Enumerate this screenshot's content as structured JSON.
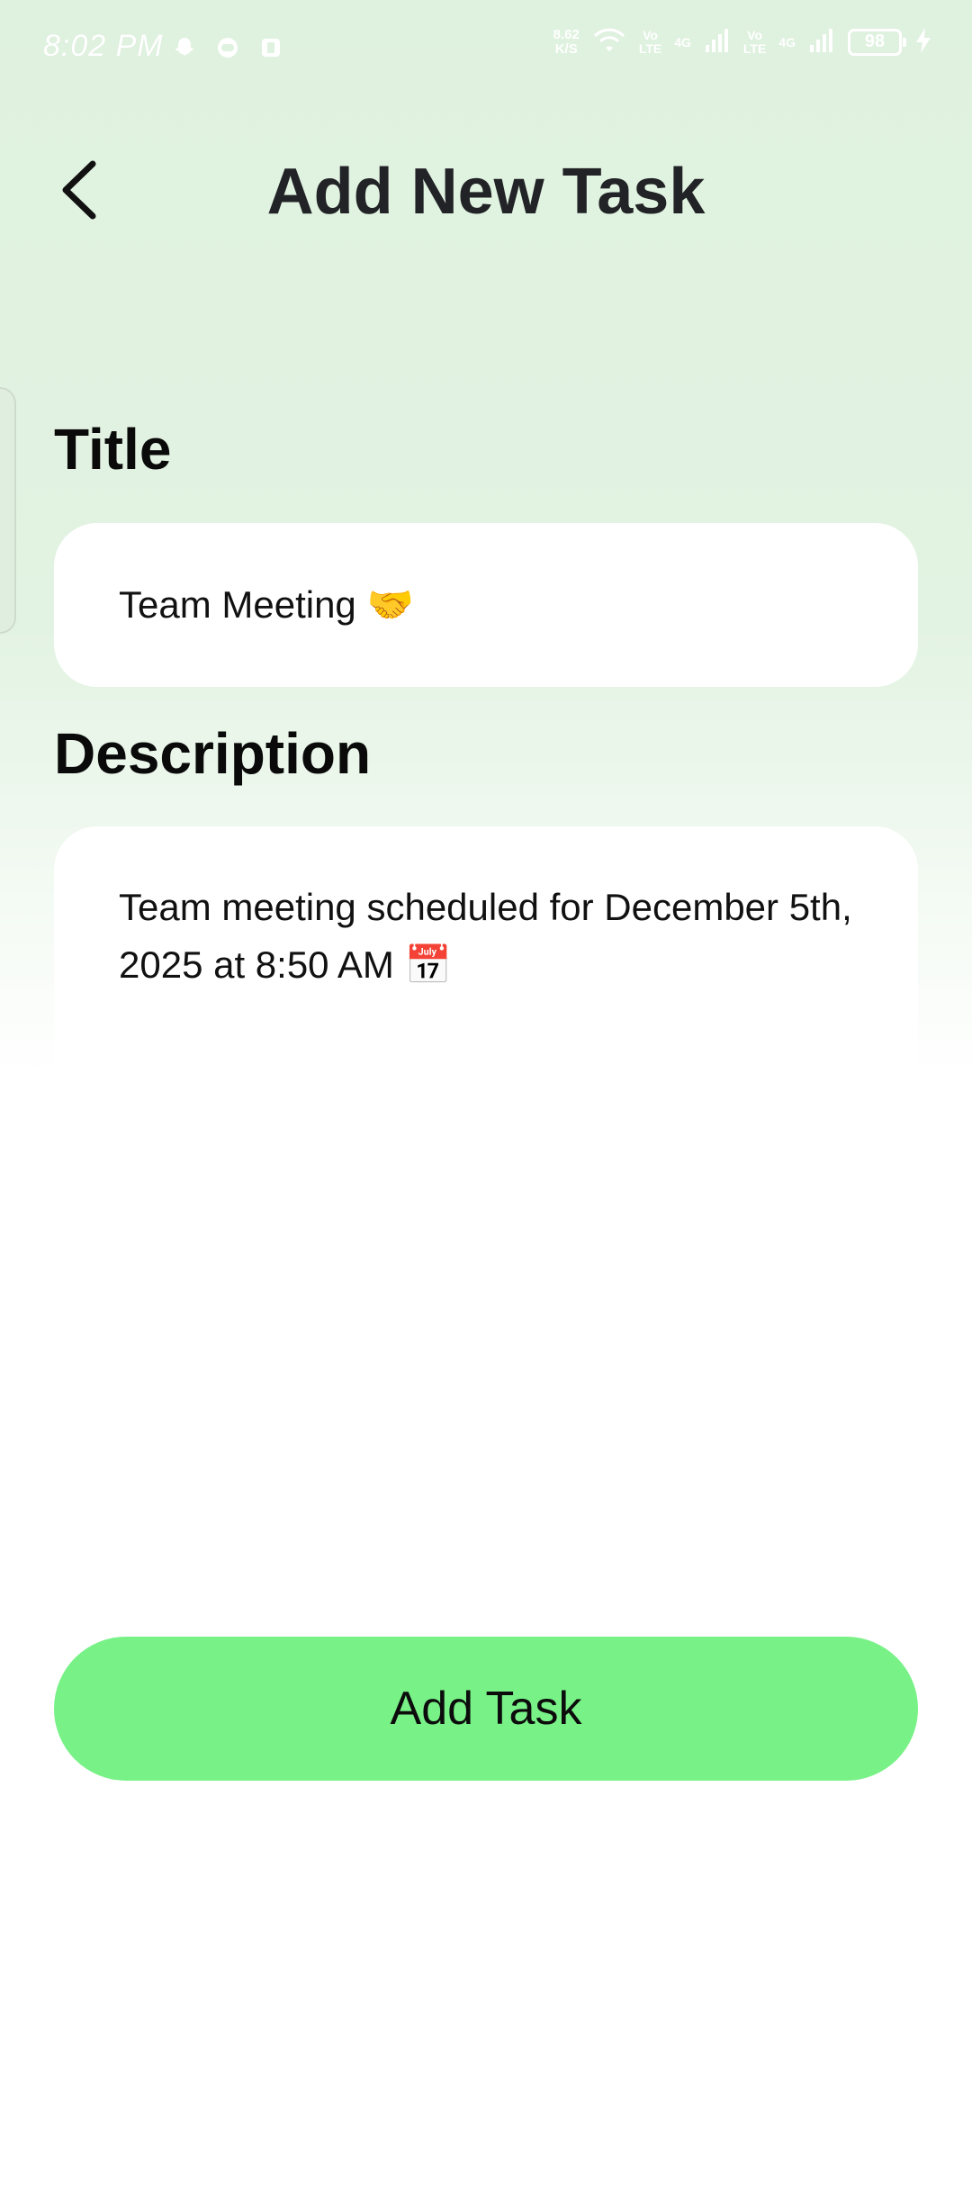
{
  "status_bar": {
    "time": "8:02 PM",
    "net_speed_value": "8.62",
    "net_speed_unit": "K/S",
    "volte_top": "Vo",
    "volte_bottom": "LTE",
    "network_1": "4G",
    "volte2_top": "Vo",
    "volte2_bottom": "LTE",
    "network_2": "4G",
    "battery_level": "98",
    "icons": [
      "snapchat-icon",
      "message-icon",
      "app-icon",
      "wifi-icon",
      "signal-icon",
      "charging-icon"
    ]
  },
  "header": {
    "title": "Add New Task",
    "back_icon": "chevron-left-icon"
  },
  "form": {
    "title_label": "Title",
    "title_value": "Team Meeting 🤝",
    "description_label": "Description",
    "description_value": "Team meeting scheduled for December 5th, 2025 at 8:50 AM 📅"
  },
  "actions": {
    "add_task_label": "Add Task"
  },
  "colors": {
    "background_top": "#dff1df",
    "button": "#78f187",
    "title_text": "#222326"
  }
}
